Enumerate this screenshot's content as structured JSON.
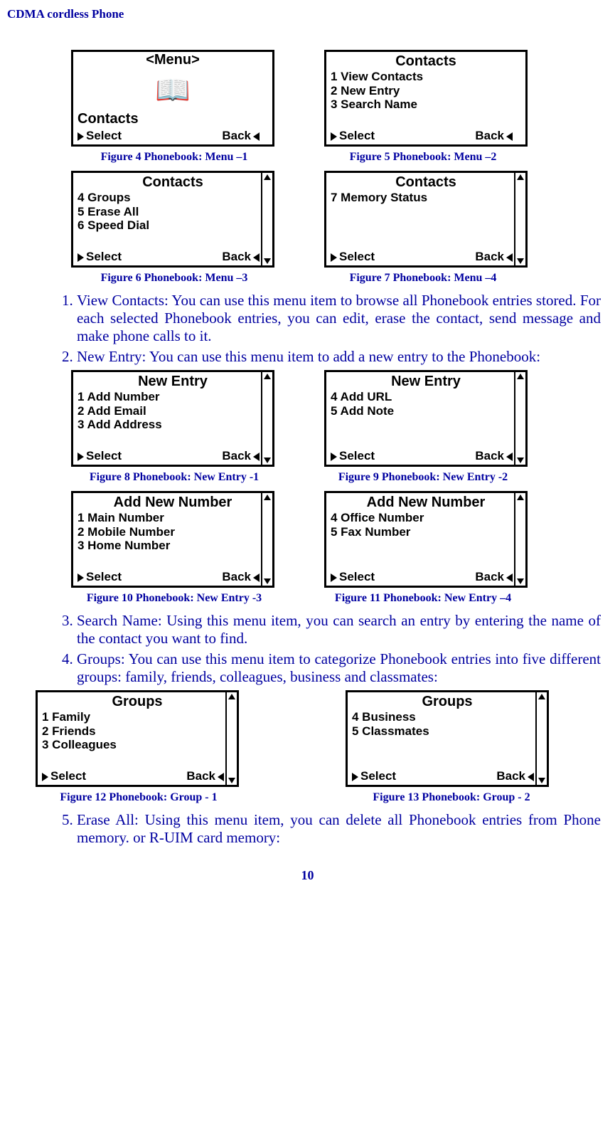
{
  "header": "CDMA cordless Phone",
  "page_number": "10",
  "screens": {
    "menu1": {
      "title": "<Menu>",
      "label": "Contacts",
      "select": "Select",
      "back": "Back"
    },
    "menu2": {
      "title": "Contacts",
      "l1": "1 View Contacts",
      "l2": "2 New Entry",
      "l3": "3 Search Name",
      "select": "Select",
      "back": "Back"
    },
    "menu3": {
      "title": "Contacts",
      "l1": "4 Groups",
      "l2": "5 Erase All",
      "l3": "6 Speed Dial",
      "select": "Select",
      "back": "Back"
    },
    "menu4": {
      "title": "Contacts",
      "l1": "7 Memory Status",
      "select": "Select",
      "back": "Back"
    },
    "ne1": {
      "title": "New Entry",
      "l1": "1 Add Number",
      "l2": "2 Add Email",
      "l3": "3 Add Address",
      "select": "Select",
      "back": "Back"
    },
    "ne2": {
      "title": "New Entry",
      "l1": "4 Add URL",
      "l2": "5 Add Note",
      "select": "Select",
      "back": "Back"
    },
    "ne3": {
      "title": "Add New Number",
      "l1": "1 Main Number",
      "l2": "2 Mobile Number",
      "l3": "3 Home Number",
      "select": "Select",
      "back": "Back"
    },
    "ne4": {
      "title": "Add New Number",
      "l1": "4 Office Number",
      "l2": "5 Fax Number",
      "select": "Select",
      "back": "Back"
    },
    "grp1": {
      "title": "Groups",
      "l1": "1 Family",
      "l2": "2 Friends",
      "l3": "3 Colleagues",
      "select": "Select",
      "back": "Back"
    },
    "grp2": {
      "title": "Groups",
      "l1": "4 Business",
      "l2": "5 Classmates",
      "select": "Select",
      "back": "Back"
    }
  },
  "captions": {
    "c4": "Figure 4 Phonebook: Menu –1",
    "c5": "Figure 5 Phonebook: Menu –2",
    "c6": "Figure 6 Phonebook: Menu –3",
    "c7": "Figure 7 Phonebook: Menu –4",
    "c8": "Figure 8 Phonebook: New Entry -1",
    "c9": "Figure 9 Phonebook: New Entry -2",
    "c10": "Figure 10 Phonebook: New Entry -3",
    "c11": "Figure 11 Phonebook: New Entry –4",
    "c12": "Figure 12 Phonebook: Group - 1",
    "c13": "Figure 13 Phonebook: Group - 2"
  },
  "text": {
    "item1": "View Contacts: You can use this menu item to browse all Phonebook entries stored. For each selected Phonebook entries, you can edit, erase  the contact, send message and make phone calls to it.",
    "item2": "New Entry: You can use this menu item to add a new entry to the Phonebook:",
    "item3": "Search Name: Using this menu item, you can search an entry by entering the name of the contact you want to find.",
    "item4": "Groups:  You can use this menu item to categorize Phonebook entries into five different groups: family, friends, colleagues, business and classmates:",
    "item5": "Erase All: Using this menu item, you can delete all Phonebook entries from Phone memory. or R-UIM card memory:"
  }
}
